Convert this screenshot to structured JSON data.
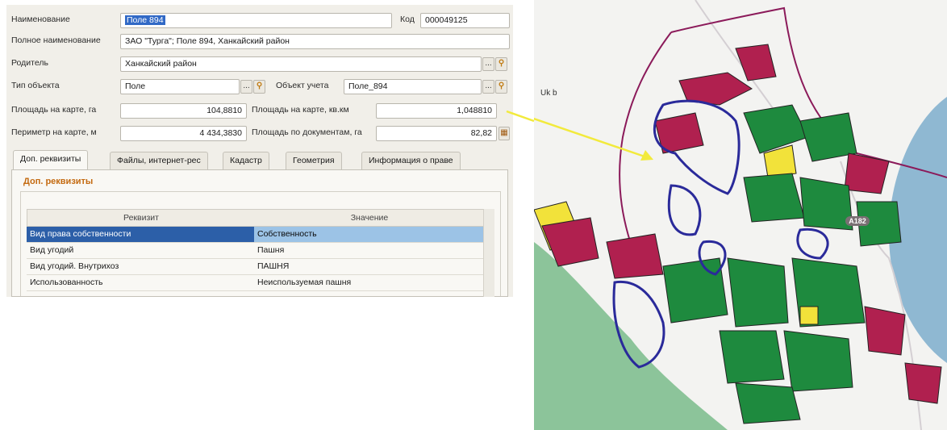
{
  "form": {
    "name_label": "Наименование",
    "name_value": "Поле 894",
    "code_label": "Код",
    "code_value": "000049125",
    "fullname_label": "Полное наименование",
    "fullname_value": "ЗАО \"Турга\"; Поле 894, Ханкайский район",
    "parent_label": "Родитель",
    "parent_value": "Ханкайский район",
    "objtype_label": "Тип объекта",
    "objtype_value": "Поле",
    "accobj_label": "Объект учета",
    "accobj_value": "Поле_894",
    "area_map_ha_label": "Площадь на карте, га",
    "area_map_ha_value": "104,8810",
    "area_map_km_label": "Площадь на карте, кв.км",
    "area_map_km_value": "1,048810",
    "perimeter_label": "Периметр на карте, м",
    "perimeter_value": "4 434,3830",
    "area_doc_label": "Площадь по документам, га",
    "area_doc_value": "82,82",
    "button_select": "...",
    "icon_search": "search-icon",
    "icon_calc": "calculator-icon"
  },
  "tabs": [
    {
      "label": "Доп. реквизиты",
      "active": true
    },
    {
      "label": "Файлы, интернет-рес",
      "active": false
    },
    {
      "label": "Кадастр",
      "active": false
    },
    {
      "label": "Геометрия",
      "active": false
    },
    {
      "label": "Информация о праве",
      "active": false
    }
  ],
  "group_title": "Доп. реквизиты",
  "table": {
    "headers": [
      "Реквизит",
      "Значение"
    ],
    "rows": [
      [
        "Вид права собственности",
        "Собственность"
      ],
      [
        "Вид угодий",
        "Пашня"
      ],
      [
        "Вид угодий. Внутрихоз",
        "ПАШНЯ"
      ],
      [
        "Использованность",
        "Неиспользуемая пашня"
      ]
    ],
    "selected_row": 0
  },
  "map": {
    "place_label": "Uk b",
    "road_label": "A182",
    "colors": {
      "background": "#f3f3f1",
      "lake": "#8fb8d2",
      "green_zone": "#8cc49a",
      "arable": "#1e8a3e",
      "unused": "#b0204f",
      "selected_field": "#2a2a9a",
      "fallow": "#f2e23a",
      "border": "#8b1a5a",
      "arrow": "#f2ea3c"
    }
  }
}
